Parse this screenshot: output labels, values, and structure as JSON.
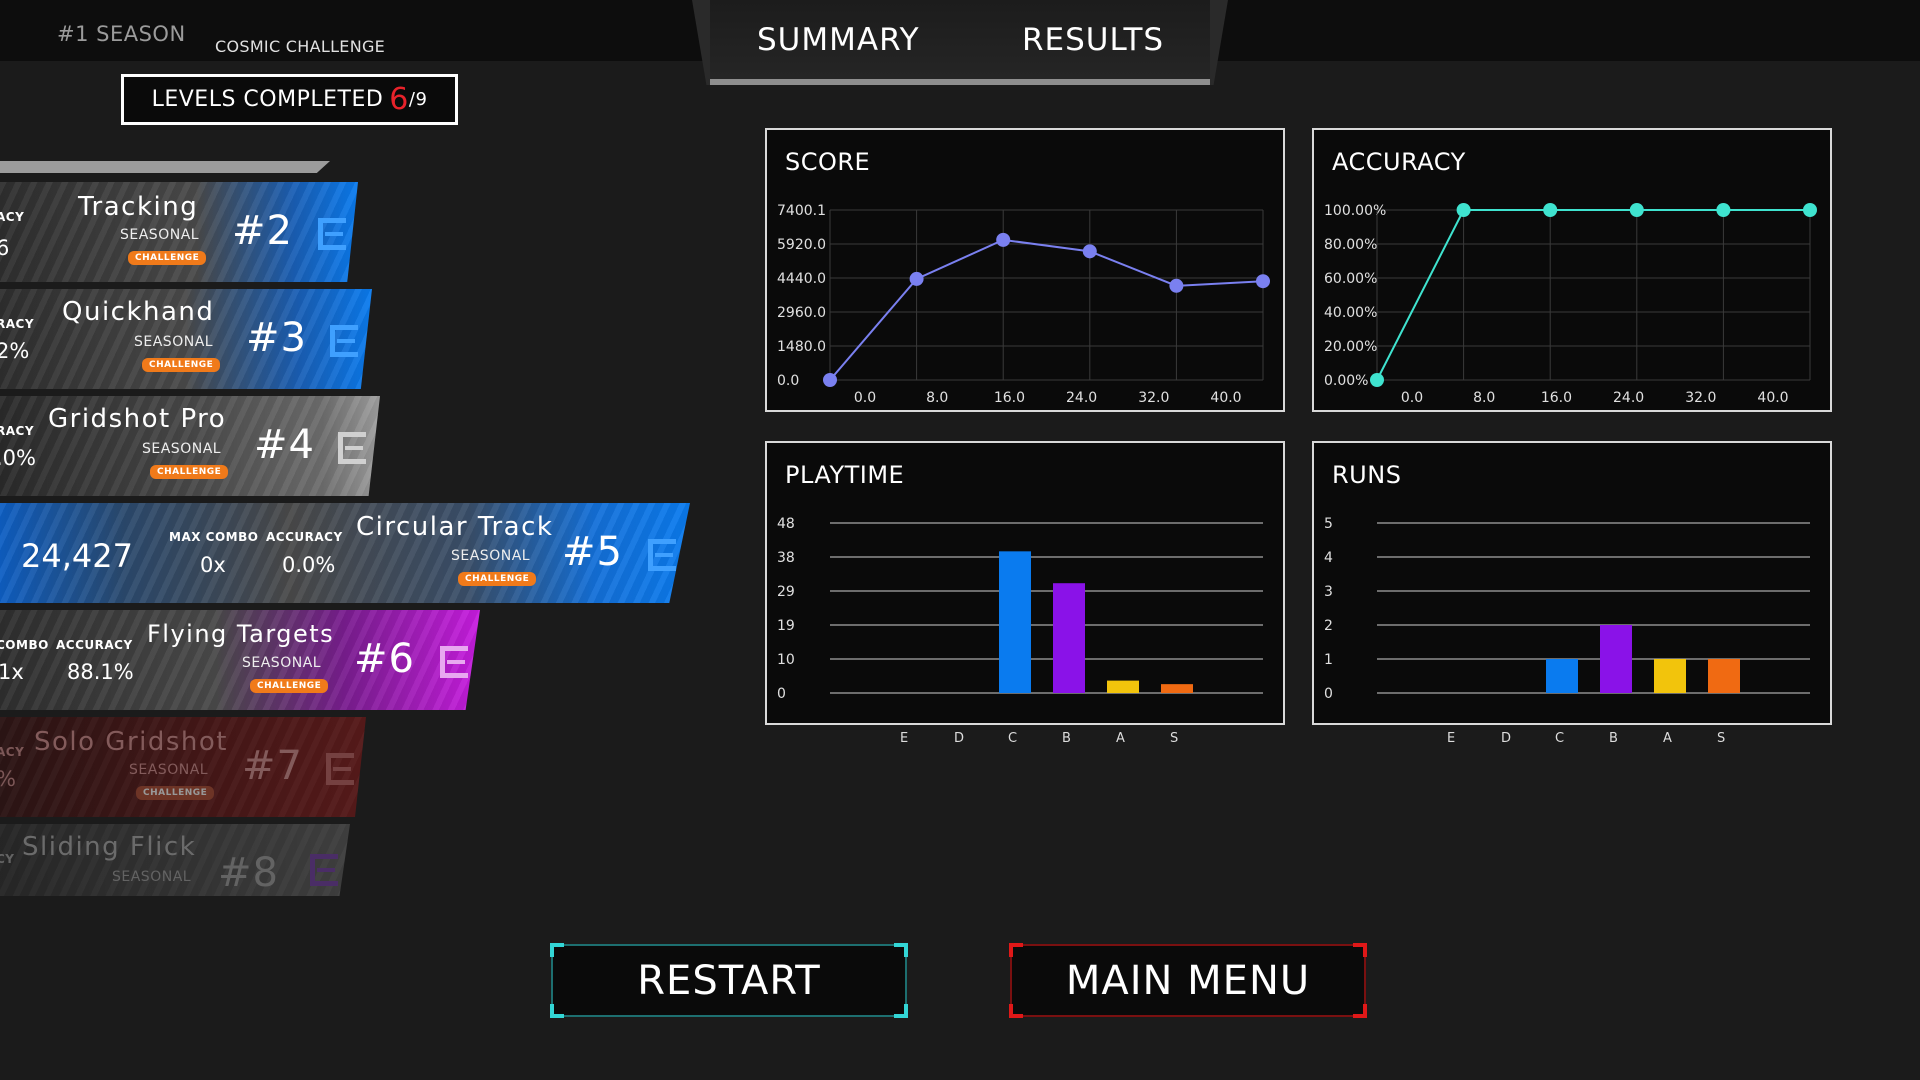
{
  "header": {
    "season": "#1 SEASON",
    "challenge": "COSMIC CHALLENGE",
    "levels_label": "LEVELS COMPLETED",
    "levels_done": "6",
    "levels_total": "/9"
  },
  "tabs": [
    {
      "label": "SUMMARY"
    },
    {
      "label": "RESULTS"
    }
  ],
  "levels": [
    {
      "title": "Tracking",
      "sub": "SEASONAL",
      "badge": "CHALLENGE",
      "num": "#2",
      "edge_label": "ACY",
      "edge_value": "6",
      "color": "#0a7bef"
    },
    {
      "title": "Quickhand",
      "sub": "SEASONAL",
      "badge": "CHALLENGE",
      "num": "#3",
      "edge_label": "RACY",
      "edge_value": "2%",
      "color": "#0a7bef"
    },
    {
      "title": "Gridshot Pro",
      "sub": "SEASONAL",
      "badge": "CHALLENGE",
      "num": "#4",
      "edge_label": "RACY",
      "edge_value": ".0%",
      "color": "#9a9a9a"
    },
    {
      "title": "Circular Track",
      "sub": "SEASONAL",
      "badge": "CHALLENGE",
      "num": "#5",
      "score": "24,427",
      "combo_label": "MAX COMBO",
      "combo_value": "0x",
      "acc_label": "ACCURACY",
      "acc_value": "0.0%",
      "color": "#0a7bef"
    },
    {
      "title": "Flying Targets",
      "sub": "SEASONAL",
      "badge": "CHALLENGE",
      "num": "#6",
      "combo_label": "COMBO",
      "combo_value": "1x",
      "acc_label": "ACCURACY",
      "acc_value": "88.1%",
      "color": "#c81ce0"
    },
    {
      "title": "Solo Gridshot",
      "sub": "SEASONAL",
      "badge": "CHALLENGE",
      "num": "#7",
      "edge_label": "ACY",
      "edge_value": "%",
      "color": "#6a1414"
    },
    {
      "title": "Sliding Flick",
      "sub": "SEASONAL",
      "num": "#8",
      "edge_label": "CY",
      "color": "#3a3a3a"
    }
  ],
  "chart_data": [
    {
      "type": "line",
      "title": "SCORE",
      "x": [
        0,
        8,
        16,
        24,
        32,
        40
      ],
      "x_ticks": [
        "0.0",
        "8.0",
        "16.0",
        "24.0",
        "32.0",
        "40.0"
      ],
      "y_ticks": [
        "0.0",
        "1480.0",
        "2960.0",
        "4440.0",
        "5920.0",
        "7400.1"
      ],
      "ylim": [
        0,
        7400.1
      ],
      "values": [
        0,
        4400,
        6100,
        5600,
        4100,
        4300
      ],
      "color": "#7a80f0"
    },
    {
      "type": "line",
      "title": "ACCURACY",
      "x": [
        0,
        8,
        16,
        24,
        32,
        40
      ],
      "x_ticks": [
        "0.0",
        "8.0",
        "16.0",
        "24.0",
        "32.0",
        "40.0"
      ],
      "y_ticks": [
        "0.00%",
        "20.00%",
        "40.00%",
        "60.00%",
        "80.00%",
        "100.00%"
      ],
      "ylim": [
        0,
        100
      ],
      "values": [
        0,
        100,
        100,
        100,
        100,
        100
      ],
      "color": "#3fe3cf"
    },
    {
      "type": "bar",
      "title": "PLAYTIME",
      "categories": [
        "E",
        "D",
        "C",
        "B",
        "A",
        "S"
      ],
      "y_ticks": [
        "0",
        "10",
        "19",
        "29",
        "38",
        "48"
      ],
      "ylim": [
        0,
        48
      ],
      "values": [
        0,
        0,
        40,
        31,
        3.5,
        2.5
      ],
      "colors": [
        "#0a7bef",
        "#0a7bef",
        "#0a7bef",
        "#8a12e8",
        "#f2c40c",
        "#f06a12"
      ]
    },
    {
      "type": "bar",
      "title": "RUNS",
      "categories": [
        "E",
        "D",
        "C",
        "B",
        "A",
        "S"
      ],
      "y_ticks": [
        "0",
        "1",
        "2",
        "3",
        "4",
        "5"
      ],
      "ylim": [
        0,
        5
      ],
      "values": [
        0,
        0,
        1,
        2,
        1,
        1
      ],
      "colors": [
        "#0a7bef",
        "#0a7bef",
        "#0a7bef",
        "#8a12e8",
        "#f2c40c",
        "#f06a12"
      ]
    }
  ],
  "buttons": {
    "restart": "RESTART",
    "main_menu": "MAIN MENU",
    "restart_color": "#33d6d6",
    "menu_color": "#e01818"
  }
}
